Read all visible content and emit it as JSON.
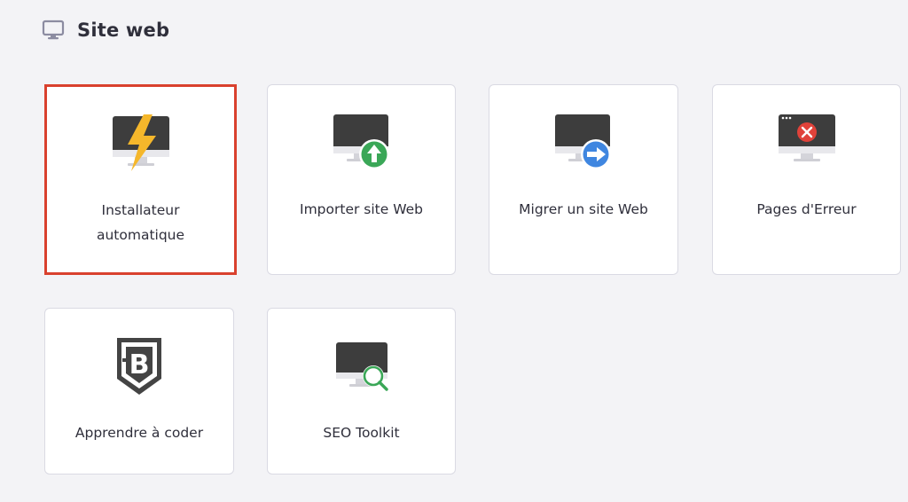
{
  "header": {
    "title": "Site web",
    "icon": "monitor-icon"
  },
  "colors": {
    "page_background": "#f3f3f6",
    "selected_border": "#d9412e",
    "card_border": "#dadae3"
  },
  "cards": [
    {
      "label_line1": "Installateur",
      "label_line2": "automatique",
      "icon": "lightning-monitor-icon",
      "selected": true
    },
    {
      "label": "Importer site Web",
      "icon": "import-upload-icon",
      "selected": false
    },
    {
      "label": "Migrer un site Web",
      "icon": "migrate-arrow-icon",
      "selected": false
    },
    {
      "label": "Pages d'Erreur",
      "icon": "error-page-icon",
      "selected": false
    },
    {
      "label": "Apprendre à coder",
      "icon": "code-badge-icon",
      "selected": false
    },
    {
      "label": "SEO Toolkit",
      "icon": "seo-magnifier-icon",
      "selected": false
    }
  ]
}
